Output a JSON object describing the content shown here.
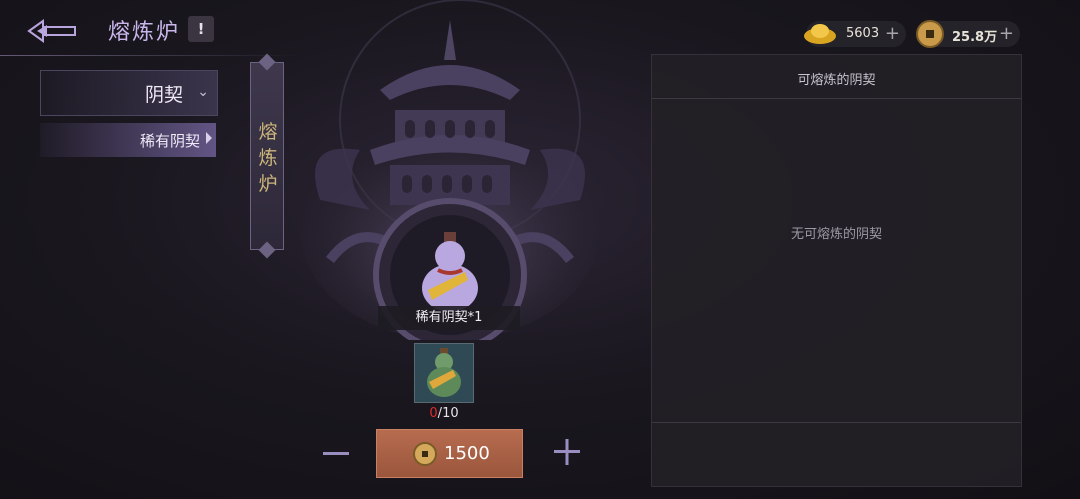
{
  "header": {
    "title": "熔炼炉",
    "help": "!"
  },
  "currency": {
    "gold": "5603",
    "coins": "25.8万",
    "plus": "+"
  },
  "menu": {
    "category": "阴契",
    "items": [
      {
        "label": "稀有阴契"
      }
    ]
  },
  "tab": {
    "chars": [
      "熔",
      "炼",
      "炉"
    ]
  },
  "center": {
    "item_caption": "稀有阴契*1",
    "count_current": "0",
    "count_sep": "/",
    "count_max": "10",
    "cost": "1500",
    "minus": "−",
    "plus": "+"
  },
  "panel": {
    "title": "可熔炼的阴契",
    "empty_text": "无可熔炼的阴契"
  },
  "colors": {
    "accent": "#c9b6ea",
    "button": "#a95f43",
    "count_red": "#e02c2c"
  }
}
